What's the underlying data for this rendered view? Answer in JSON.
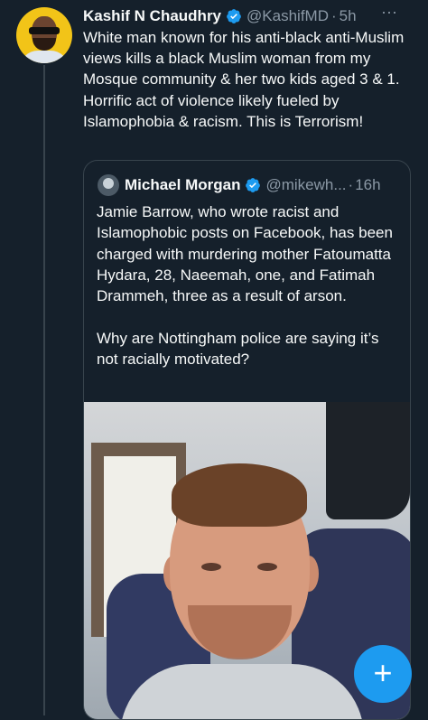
{
  "tweet": {
    "author_name": "Kashif N Chaudhry",
    "author_handle": "@KashifMD",
    "separator": "·",
    "time": "5h",
    "more_icon": "more-dots-icon",
    "text": "White man known for his anti-black anti-Muslim views kills a black Muslim woman from my Mosque community & her two kids aged 3 & 1. Horrific act of violence likely fueled by Islamophobia & racism. This is Terrorism!"
  },
  "quoted_tweet": {
    "author_name": "Michael Morgan",
    "author_handle": "@mikewh...",
    "separator": "·",
    "time": "16h",
    "text": "Jamie Barrow, who wrote racist and Islamophobic posts on Facebook, has been charged with murdering mother Fatoumatta Hydara, 28, Naeemah, one, and Fatimah Drammeh, three as a result of arson.\n\nWhy are Nottingham police are saying it’s not racially motivated?"
  },
  "compose_button": {
    "label": "+"
  },
  "colors": {
    "background": "#15202b",
    "text": "#f7f9f9",
    "secondary_text": "#8b98a5",
    "accent": "#1d9bf0",
    "border": "#38444d"
  }
}
